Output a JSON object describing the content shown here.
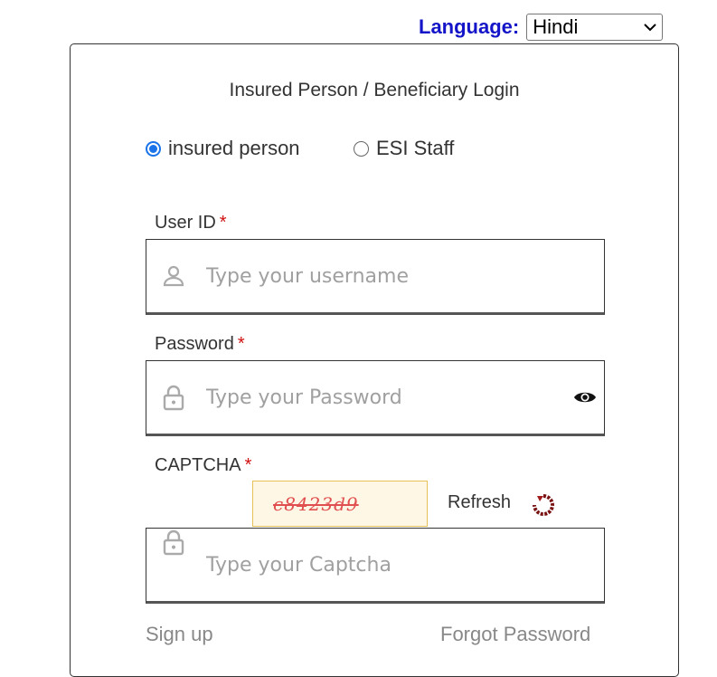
{
  "language": {
    "label": "Language:",
    "selected": "Hindi"
  },
  "login": {
    "title": "Insured Person / Beneficiary Login",
    "roles": [
      {
        "label": "insured person",
        "checked": true
      },
      {
        "label": "ESI Staff",
        "checked": false
      }
    ],
    "userid": {
      "label": "User ID",
      "required": "*",
      "placeholder": "Type your username"
    },
    "password": {
      "label": "Password",
      "required": "*",
      "placeholder": "Type your Password"
    },
    "captcha": {
      "label": "CAPTCHA",
      "required": "*",
      "code": "c8423d9",
      "refresh_label": "Refresh",
      "placeholder": "Type your Captcha"
    },
    "signup_label": "Sign up",
    "forgot_label": "Forgot Password"
  },
  "icons": {
    "user": "user-icon",
    "lock": "lock-icon",
    "eye": "eye-icon",
    "refresh": "refresh-icon",
    "chevron": "chevron-down-icon"
  },
  "colors": {
    "language_label": "#1414c8",
    "required": "#d01010",
    "radio_accent": "#1a73e8",
    "captcha_text": "#e05050",
    "captcha_border": "#e6c15a"
  }
}
